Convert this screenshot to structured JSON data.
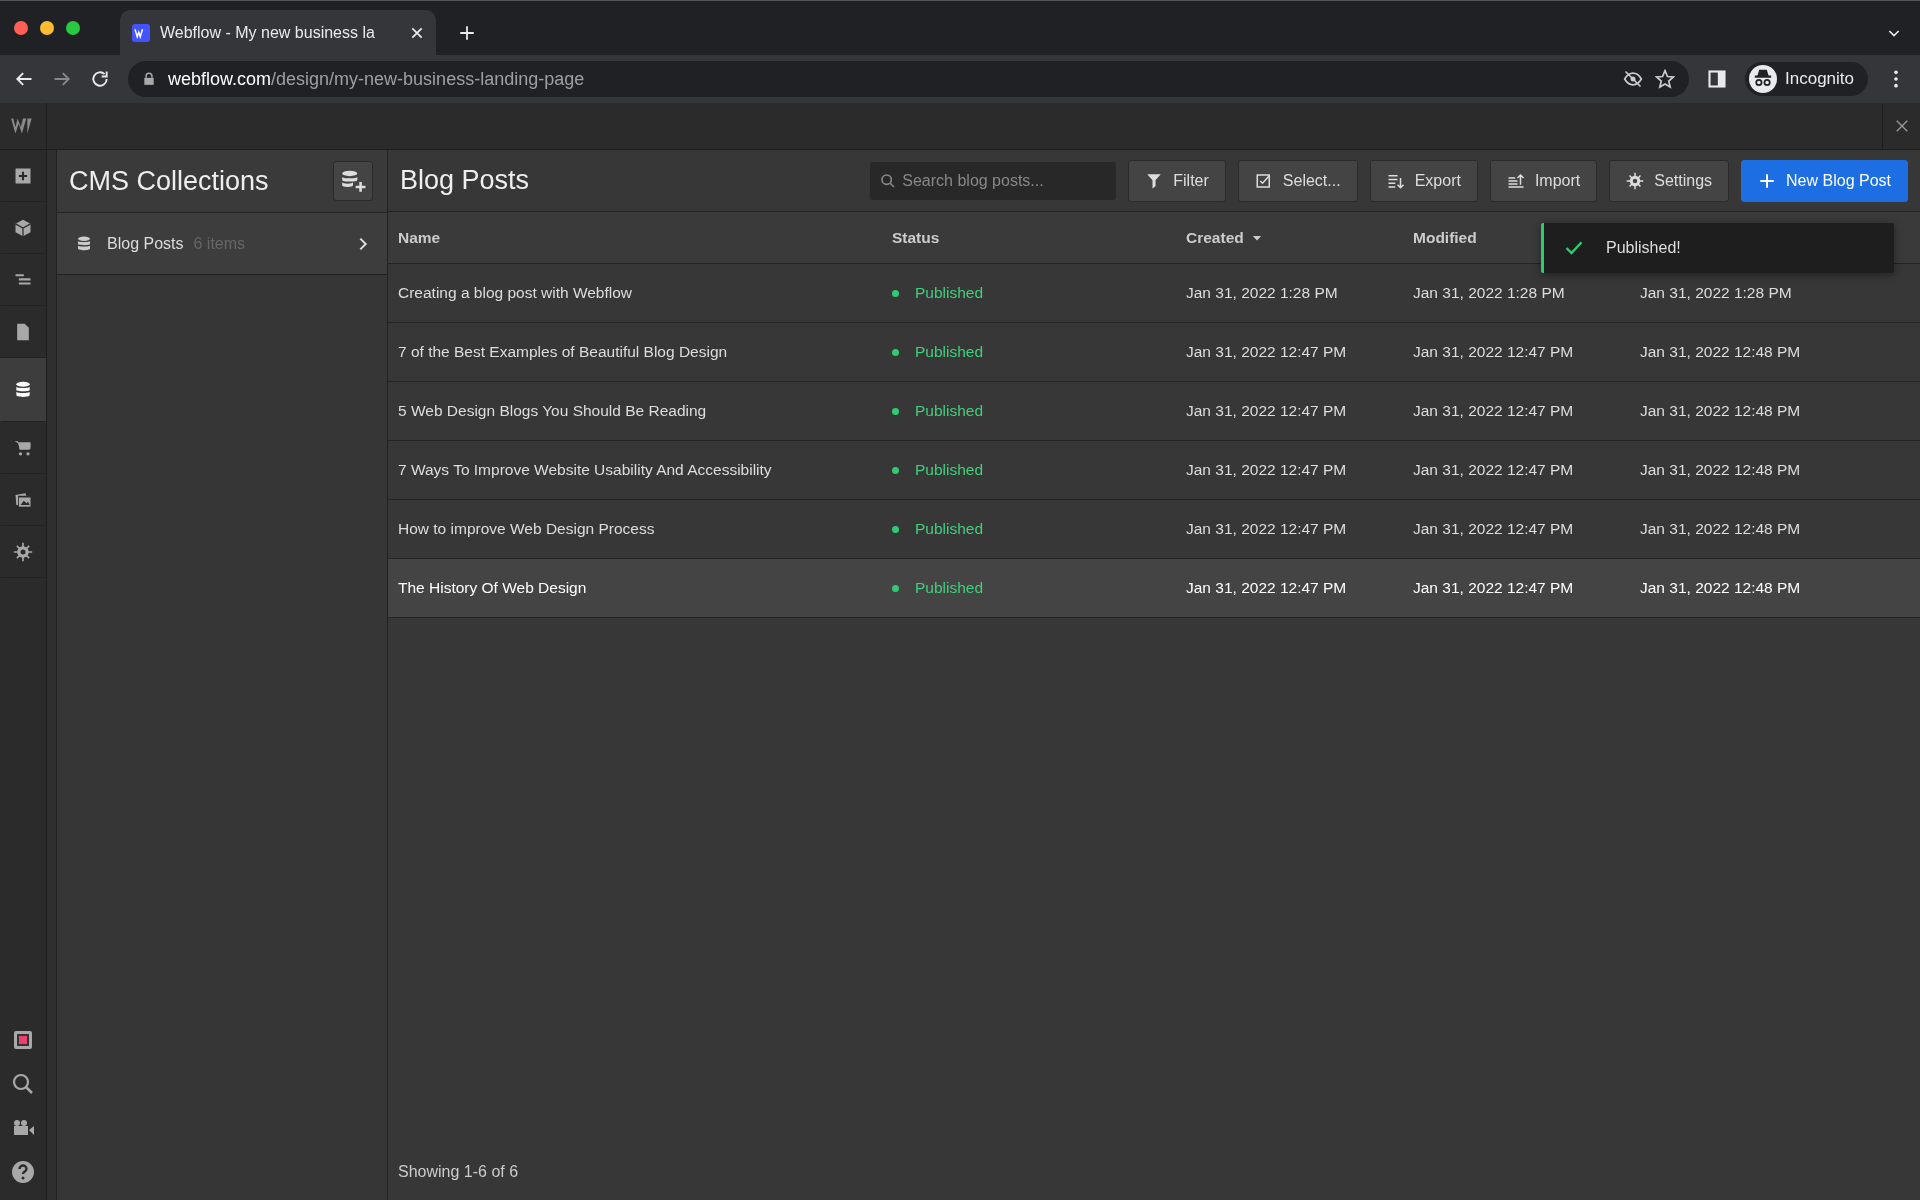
{
  "browser": {
    "tab_title": "Webflow - My new business la",
    "url_host": "webflow.com",
    "url_path": "/design/my-new-business-landing-page",
    "profile": "Incognito"
  },
  "rail": {
    "top": [
      {
        "kind": "logo"
      },
      {
        "kind": "add",
        "selected": false
      },
      {
        "kind": "cube",
        "selected": false
      },
      {
        "kind": "navigator",
        "selected": false
      },
      {
        "kind": "page",
        "selected": false
      },
      {
        "kind": "cms",
        "selected": true
      },
      {
        "kind": "cart",
        "selected": false
      },
      {
        "kind": "assets",
        "selected": false
      },
      {
        "kind": "settings",
        "selected": false
      }
    ],
    "bottom": [
      {
        "kind": "record"
      },
      {
        "kind": "search"
      },
      {
        "kind": "video"
      },
      {
        "kind": "help"
      }
    ]
  },
  "collections": {
    "title": "CMS Collections",
    "items": [
      {
        "name": "Blog Posts",
        "count": "6 items"
      }
    ]
  },
  "main": {
    "title": "Blog Posts",
    "search": {
      "placeholder": "Search blog posts..."
    },
    "buttons": [
      {
        "kind": "filter",
        "label": "Filter"
      },
      {
        "kind": "select",
        "label": "Select..."
      },
      {
        "kind": "export",
        "label": "Export"
      },
      {
        "kind": "import",
        "label": "Import"
      },
      {
        "kind": "settings",
        "label": "Settings"
      },
      {
        "kind": "new",
        "label": "New Blog Post"
      }
    ],
    "table": {
      "columns": [
        {
          "label": "Name",
          "sorted": false
        },
        {
          "label": "Status",
          "sorted": false
        },
        {
          "label": "Created",
          "sorted": true
        },
        {
          "label": "Modified",
          "sorted": false
        }
      ],
      "rows": [
        {
          "name": "Creating a blog post with Webflow",
          "status": "Published",
          "created": "Jan 31, 2022 1:28 PM",
          "modified": "Jan 31, 2022 1:28 PM",
          "column_5": "Jan 31, 2022 1:28 PM",
          "hovered": false
        },
        {
          "name": "7 of the Best Examples of Beautiful Blog Design",
          "status": "Published",
          "created": "Jan 31, 2022 12:47 PM",
          "modified": "Jan 31, 2022 12:47 PM",
          "column_5": "Jan 31, 2022 12:48 PM",
          "hovered": false
        },
        {
          "name": "5 Web Design Blogs You Should Be Reading",
          "status": "Published",
          "created": "Jan 31, 2022 12:47 PM",
          "modified": "Jan 31, 2022 12:47 PM",
          "column_5": "Jan 31, 2022 12:48 PM",
          "hovered": false
        },
        {
          "name": "7 Ways To Improve Website Usability And Accessibility",
          "status": "Published",
          "created": "Jan 31, 2022 12:47 PM",
          "modified": "Jan 31, 2022 12:47 PM",
          "column_5": "Jan 31, 2022 12:48 PM",
          "hovered": false
        },
        {
          "name": "How to improve Web Design Process",
          "status": "Published",
          "created": "Jan 31, 2022 12:47 PM",
          "modified": "Jan 31, 2022 12:47 PM",
          "column_5": "Jan 31, 2022 12:48 PM",
          "hovered": false
        },
        {
          "name": "The History Of Web Design",
          "status": "Published",
          "created": "Jan 31, 2022 12:47 PM",
          "modified": "Jan 31, 2022 12:47 PM",
          "column_5": "Jan 31, 2022 12:48 PM",
          "hovered": true
        }
      ]
    },
    "footer": "Showing 1-6 of 6"
  },
  "toast": {
    "message": "Published!"
  }
}
